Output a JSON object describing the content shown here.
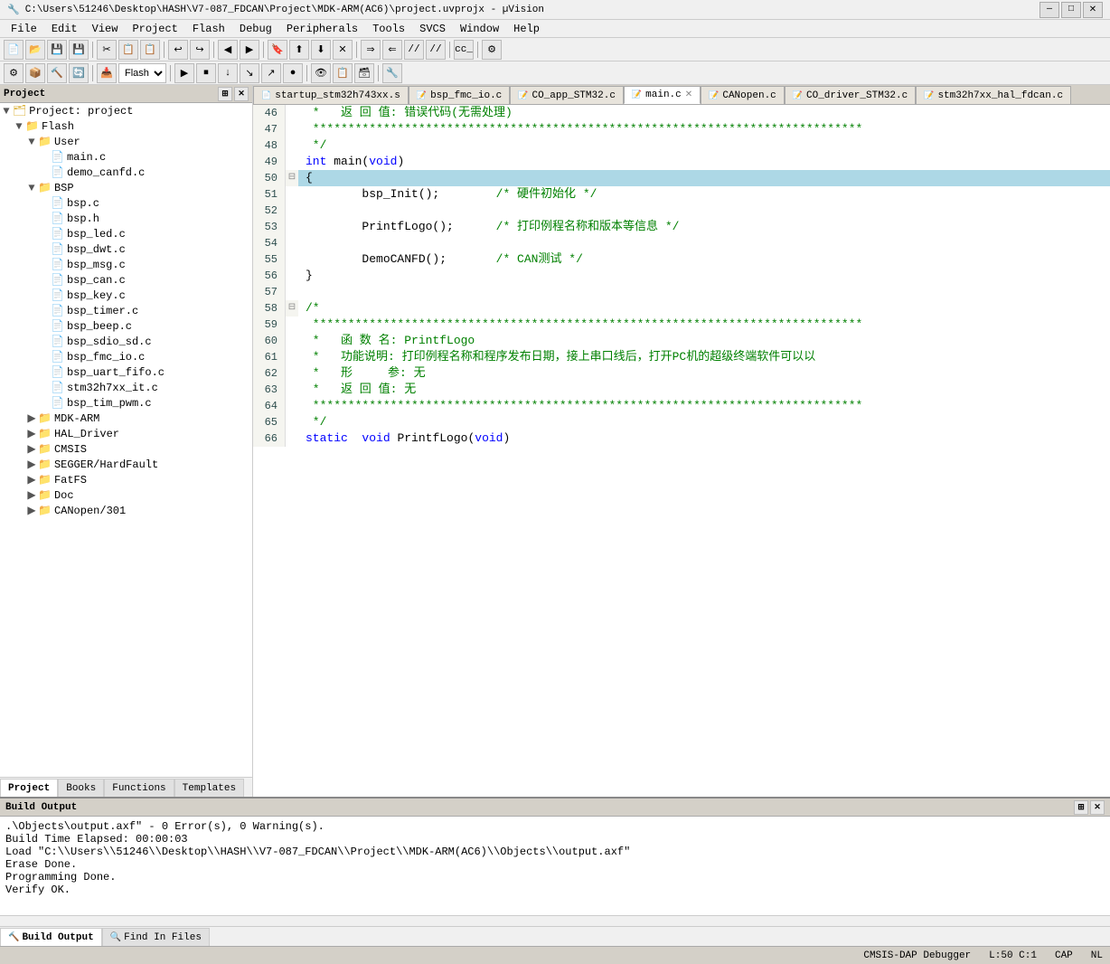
{
  "titlebar": {
    "text": "C:\\Users\\51246\\Desktop\\HASH\\V7-087_FDCAN\\Project\\MDK-ARM(AC6)\\project.uvprojx - µVision",
    "minimize": "—",
    "maximize": "□",
    "close": "✕"
  },
  "menu": {
    "items": [
      "File",
      "Edit",
      "View",
      "Project",
      "Flash",
      "Debug",
      "Peripherals",
      "Tools",
      "SVCS",
      "Window",
      "Help"
    ]
  },
  "toolbar2": {
    "flash_label": "Flash",
    "cc_label": "cc_"
  },
  "project_panel": {
    "title": "Project",
    "tree": [
      {
        "id": "root",
        "label": "Project: project",
        "indent": 0,
        "type": "root",
        "expanded": true
      },
      {
        "id": "flash",
        "label": "Flash",
        "indent": 1,
        "type": "folder",
        "expanded": true
      },
      {
        "id": "user",
        "label": "User",
        "indent": 2,
        "type": "folder",
        "expanded": true
      },
      {
        "id": "main_c",
        "label": "main.c",
        "indent": 3,
        "type": "file"
      },
      {
        "id": "demo_canfd",
        "label": "demo_canfd.c",
        "indent": 3,
        "type": "file"
      },
      {
        "id": "bsp",
        "label": "BSP",
        "indent": 2,
        "type": "folder",
        "expanded": true
      },
      {
        "id": "bsp_c",
        "label": "bsp.c",
        "indent": 3,
        "type": "file"
      },
      {
        "id": "bsp_h",
        "label": "bsp.h",
        "indent": 3,
        "type": "file"
      },
      {
        "id": "bsp_led",
        "label": "bsp_led.c",
        "indent": 3,
        "type": "file"
      },
      {
        "id": "bsp_dwt",
        "label": "bsp_dwt.c",
        "indent": 3,
        "type": "file"
      },
      {
        "id": "bsp_msg",
        "label": "bsp_msg.c",
        "indent": 3,
        "type": "file"
      },
      {
        "id": "bsp_can",
        "label": "bsp_can.c",
        "indent": 3,
        "type": "file"
      },
      {
        "id": "bsp_key",
        "label": "bsp_key.c",
        "indent": 3,
        "type": "file"
      },
      {
        "id": "bsp_timer",
        "label": "bsp_timer.c",
        "indent": 3,
        "type": "file"
      },
      {
        "id": "bsp_beep",
        "label": "bsp_beep.c",
        "indent": 3,
        "type": "file"
      },
      {
        "id": "bsp_sdio_sd",
        "label": "bsp_sdio_sd.c",
        "indent": 3,
        "type": "file"
      },
      {
        "id": "bsp_fmc_io",
        "label": "bsp_fmc_io.c",
        "indent": 3,
        "type": "file"
      },
      {
        "id": "bsp_uart_fifo",
        "label": "bsp_uart_fifo.c",
        "indent": 3,
        "type": "file"
      },
      {
        "id": "stm32h7xx_it",
        "label": "stm32h7xx_it.c",
        "indent": 3,
        "type": "file"
      },
      {
        "id": "bsp_tim_pwm",
        "label": "bsp_tim_pwm.c",
        "indent": 3,
        "type": "file"
      },
      {
        "id": "mdk_arm",
        "label": "MDK-ARM",
        "indent": 2,
        "type": "folder",
        "expanded": false
      },
      {
        "id": "hal_driver",
        "label": "HAL_Driver",
        "indent": 2,
        "type": "folder",
        "expanded": false
      },
      {
        "id": "cmsis",
        "label": "CMSIS",
        "indent": 2,
        "type": "folder",
        "expanded": false
      },
      {
        "id": "segger",
        "label": "SEGGER/HardFault",
        "indent": 2,
        "type": "folder",
        "expanded": false
      },
      {
        "id": "fatfs",
        "label": "FatFS",
        "indent": 2,
        "type": "folder",
        "expanded": false
      },
      {
        "id": "doc",
        "label": "Doc",
        "indent": 2,
        "type": "folder",
        "expanded": false
      },
      {
        "id": "canopen",
        "label": "CANopen/301",
        "indent": 2,
        "type": "folder",
        "expanded": false
      }
    ],
    "tabs": [
      "Project",
      "Books",
      "Functions",
      "Templates"
    ]
  },
  "editor": {
    "tabs": [
      {
        "label": "startup_stm32h743xx.s",
        "active": false
      },
      {
        "label": "bsp_fmc_io.c",
        "active": false
      },
      {
        "label": "CO_app_STM32.c",
        "active": false
      },
      {
        "label": "main.c",
        "active": true
      },
      {
        "label": "CANopen.c",
        "active": false
      },
      {
        "label": "CO_driver_STM32.c",
        "active": false
      },
      {
        "label": "stm32h7xx_hal_fdcan.c",
        "active": false
      }
    ],
    "lines": [
      {
        "num": 46,
        "fold": " ",
        "content": " *   返 回 值: 错误代码(无需处理)",
        "type": "comment"
      },
      {
        "num": 47,
        "fold": " ",
        "content": " ******************************************************************************",
        "type": "comment"
      },
      {
        "num": 48,
        "fold": " ",
        "content": " */",
        "type": "comment"
      },
      {
        "num": 49,
        "fold": " ",
        "content": "int main(void)",
        "type": "code"
      },
      {
        "num": 50,
        "fold": "⊟",
        "content": "{",
        "type": "code",
        "highlight": true
      },
      {
        "num": 51,
        "fold": " ",
        "content": "\tbsp_Init();        /* 硬件初始化 */",
        "type": "code"
      },
      {
        "num": 52,
        "fold": " ",
        "content": "",
        "type": "code"
      },
      {
        "num": 53,
        "fold": " ",
        "content": "\tPrintfLogo();      /* 打印例程名称和版本等信息 */",
        "type": "code"
      },
      {
        "num": 54,
        "fold": " ",
        "content": "",
        "type": "code"
      },
      {
        "num": 55,
        "fold": " ",
        "content": "\tDemoCANFD();       /* CAN测试 */",
        "type": "code"
      },
      {
        "num": 56,
        "fold": " ",
        "content": "}",
        "type": "code"
      },
      {
        "num": 57,
        "fold": " ",
        "content": "",
        "type": "code"
      },
      {
        "num": 58,
        "fold": "⊟",
        "content": "/*",
        "type": "comment"
      },
      {
        "num": 59,
        "fold": " ",
        "content": " ******************************************************************************",
        "type": "comment"
      },
      {
        "num": 60,
        "fold": " ",
        "content": " *   函 数 名: PrintfLogo",
        "type": "comment"
      },
      {
        "num": 61,
        "fold": " ",
        "content": " *   功能说明: 打印例程名称和程序发布日期，接上串口线后，打开PC机的超级终端软件可以以",
        "type": "comment"
      },
      {
        "num": 62,
        "fold": " ",
        "content": " *   形     参: 无",
        "type": "comment"
      },
      {
        "num": 63,
        "fold": " ",
        "content": " *   返 回 值: 无",
        "type": "comment"
      },
      {
        "num": 64,
        "fold": " ",
        "content": " ******************************************************************************",
        "type": "comment"
      },
      {
        "num": 65,
        "fold": " ",
        "content": " */",
        "type": "comment"
      },
      {
        "num": 66,
        "fold": " ",
        "content": "static  void PrintfLogo(void)",
        "type": "code"
      }
    ]
  },
  "build_output": {
    "title": "Build Output",
    "lines": [
      ".\\Objects\\output.axf\" - 0 Error(s), 0 Warning(s).",
      "Build Time Elapsed:  00:00:03",
      "Load \"C:\\\\Users\\\\51246\\\\Desktop\\\\HASH\\\\V7-087_FDCAN\\\\Project\\\\MDK-ARM(AC6)\\\\Objects\\\\output.axf\"",
      "Erase Done.",
      "Programming Done.",
      "Verify OK."
    ]
  },
  "bottom_tabs": [
    "Build Output",
    "Find In Files"
  ],
  "statusbar": {
    "debugger": "CMSIS-DAP Debugger",
    "position": "L:50 C:1",
    "caps": "CAP",
    "nl": "NL"
  }
}
